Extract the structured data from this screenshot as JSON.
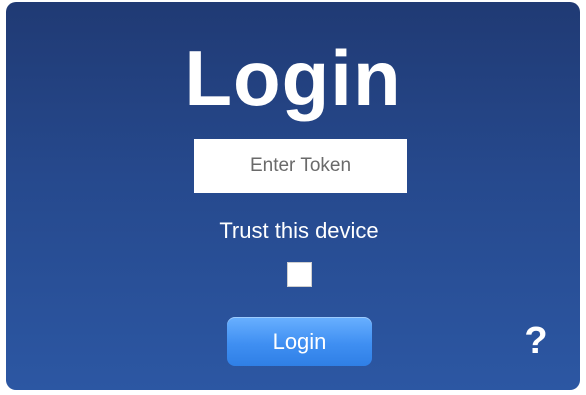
{
  "login_form": {
    "title": "Login",
    "token_input": {
      "placeholder": "Enter Token",
      "value": ""
    },
    "trust_label": "Trust this device",
    "trust_checked": false,
    "login_button_label": "Login",
    "help_icon": {
      "name": "question-mark-icon",
      "glyph": "?"
    }
  },
  "colors": {
    "panel_top": "#203a74",
    "panel_bottom": "#2c57a3",
    "button_top": "#69b0ff",
    "button_bottom": "#2f7fe6"
  }
}
